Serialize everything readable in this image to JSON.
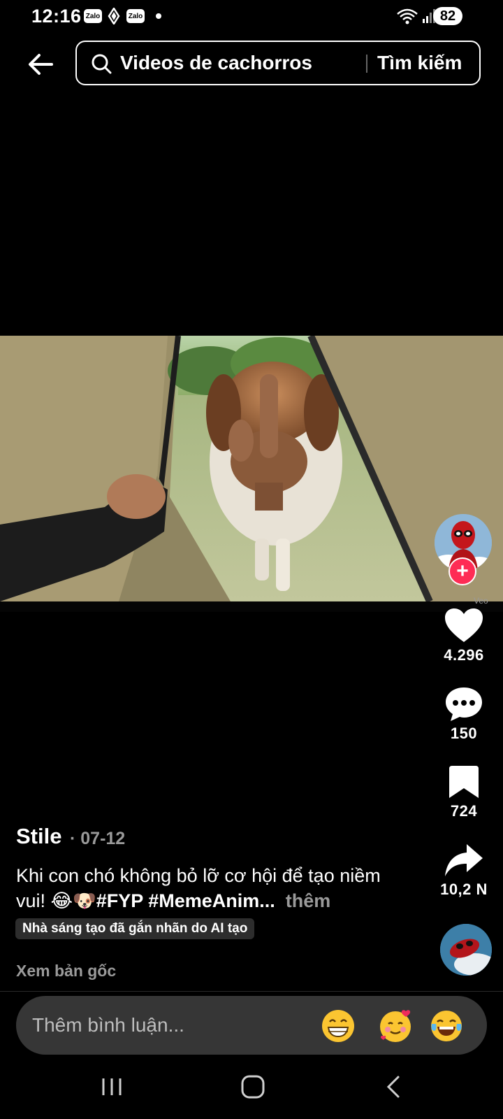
{
  "status_bar": {
    "time": "12:16",
    "notification_icons": [
      "Zalo",
      "Zalo"
    ],
    "battery": "82"
  },
  "search": {
    "query": "Videos de cachorros",
    "button_label": "Tìm kiếm"
  },
  "post": {
    "author": "Stile",
    "date": "· 07-12",
    "caption_text": "Khi con chó không bỏ lỡ cơ hội để tạo niềm vui! 😂🐶",
    "caption_tags": "#FYP #MemeAnim...",
    "caption_more": "thêm",
    "ai_label": "Nhà sáng tạo đã gắn nhãn do AI tạo",
    "see_original": "Xem bản gốc"
  },
  "rail": {
    "veo_label": "Veo",
    "likes": "4.296",
    "comments": "150",
    "saves": "724",
    "shares": "10,2 N"
  },
  "comment_bar": {
    "placeholder": "Thêm bình luận...",
    "emojis": [
      "😁",
      "🥰",
      "😂"
    ]
  },
  "icons": {
    "back": "arrow-left-icon",
    "search": "magnifier-icon",
    "like": "heart-icon",
    "comment": "chat-bubble-icon",
    "save": "bookmark-icon",
    "share": "share-arrow-icon"
  },
  "colors": {
    "background": "#000000",
    "follow_accent": "#fe2c55",
    "muted_text": "#9a9a9a",
    "comment_bar": "#363636"
  }
}
